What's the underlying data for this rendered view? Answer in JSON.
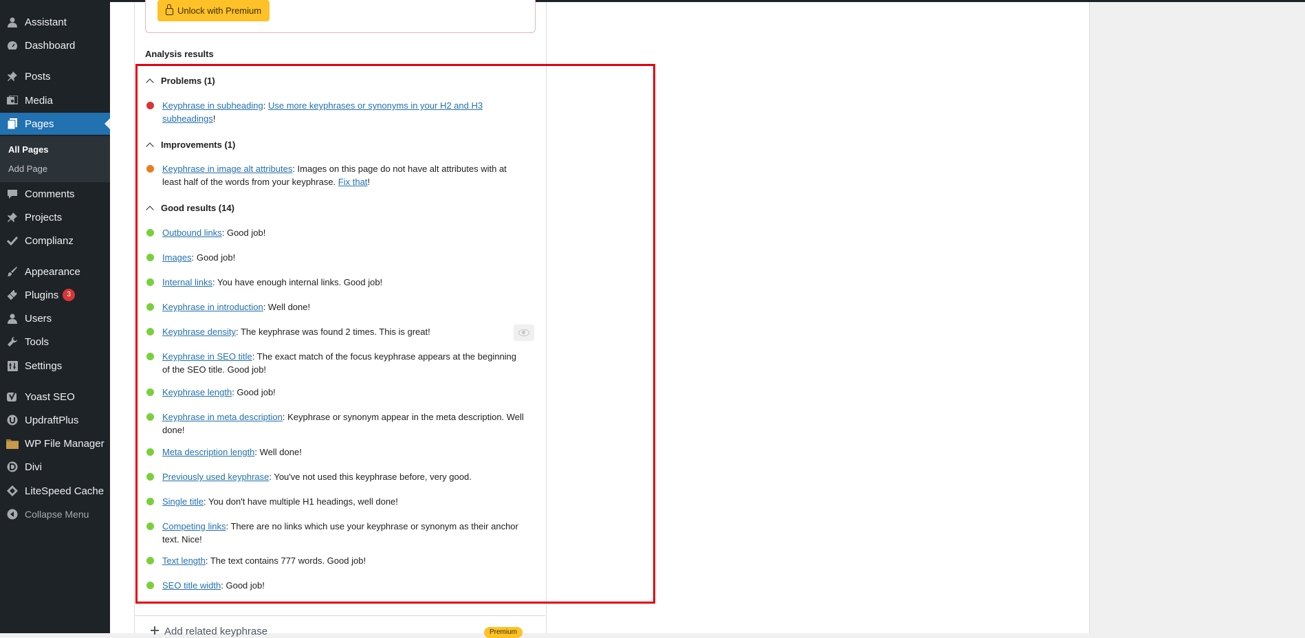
{
  "sidebar": {
    "items": [
      {
        "label": "Assistant",
        "icon": "person-icon"
      },
      {
        "label": "Dashboard",
        "icon": "gauge-icon"
      },
      {
        "label": "Posts",
        "icon": "pin-icon"
      },
      {
        "label": "Media",
        "icon": "media-icon"
      },
      {
        "label": "Pages",
        "icon": "pages-icon"
      },
      {
        "label": "Comments",
        "icon": "comment-icon"
      },
      {
        "label": "Projects",
        "icon": "pin-icon"
      },
      {
        "label": "Complianz",
        "icon": "check-icon"
      },
      {
        "label": "Appearance",
        "icon": "brush-icon"
      },
      {
        "label": "Plugins",
        "icon": "plug-icon",
        "badge": "3"
      },
      {
        "label": "Users",
        "icon": "person-icon"
      },
      {
        "label": "Tools",
        "icon": "wrench-icon"
      },
      {
        "label": "Settings",
        "icon": "settings-icon"
      },
      {
        "label": "Yoast SEO",
        "icon": "yoast-icon"
      },
      {
        "label": "UpdraftPlus",
        "icon": "updraft-icon"
      },
      {
        "label": "WP File Manager",
        "icon": "folder-icon"
      },
      {
        "label": "Divi",
        "icon": "divi-icon"
      },
      {
        "label": "LiteSpeed Cache",
        "icon": "diamond-icon"
      },
      {
        "label": "Collapse Menu",
        "icon": "collapse-icon"
      }
    ],
    "submenu": [
      "All Pages",
      "Add Page"
    ]
  },
  "premium": {
    "unlock_label": "Unlock with Premium"
  },
  "analysis": {
    "title": "Analysis results",
    "groups": {
      "problems": "Problems (1)",
      "improvements": "Improvements (1)",
      "good": "Good results (14)"
    },
    "problems": [
      {
        "link": "Keyphrase in subheading",
        "sep": ": ",
        "link2": "Use more keyphrases or synonyms in your H2 and H3 subheadings",
        "end": "!"
      }
    ],
    "improvements": [
      {
        "link": "Keyphrase in image alt attributes",
        "text": ": Images on this page do not have alt attributes with at least half of the words from your keyphrase. ",
        "link2": "Fix that",
        "end": "!"
      }
    ],
    "good": [
      {
        "link": "Outbound links",
        "text": ": Good job!"
      },
      {
        "link": "Images",
        "text": ": Good job!"
      },
      {
        "link": "Internal links",
        "text": ": You have enough internal links. Good job!"
      },
      {
        "link": "Keyphrase in introduction",
        "text": ": Well done!"
      },
      {
        "link": "Keyphrase density",
        "text": ": The keyphrase was found 2 times. This is great!"
      },
      {
        "link": "Keyphrase in SEO title",
        "text": ": The exact match of the focus keyphrase appears at the beginning of the SEO title. Good job!"
      },
      {
        "link": "Keyphrase length",
        "text": ": Good job!"
      },
      {
        "link": "Keyphrase in meta description",
        "text": ": Keyphrase or synonym appear in the meta description. Well done!"
      },
      {
        "link": "Meta description length",
        "text": ": Well done!"
      },
      {
        "link": "Previously used keyphrase",
        "text": ": You've not used this keyphrase before, very good."
      },
      {
        "link": "Single title",
        "text": ": You don't have multiple H1 headings, well done!"
      },
      {
        "link": "Competing links",
        "text": ": There are no links which use your keyphrase or synonym as their anchor text. Nice!"
      },
      {
        "link": "Text length",
        "text": ": The text contains 777 words. Good job!"
      },
      {
        "link": "SEO title width",
        "text": ": Good job!"
      }
    ]
  },
  "related": {
    "label": "Add related keyphrase",
    "premium_badge": "Premium"
  }
}
